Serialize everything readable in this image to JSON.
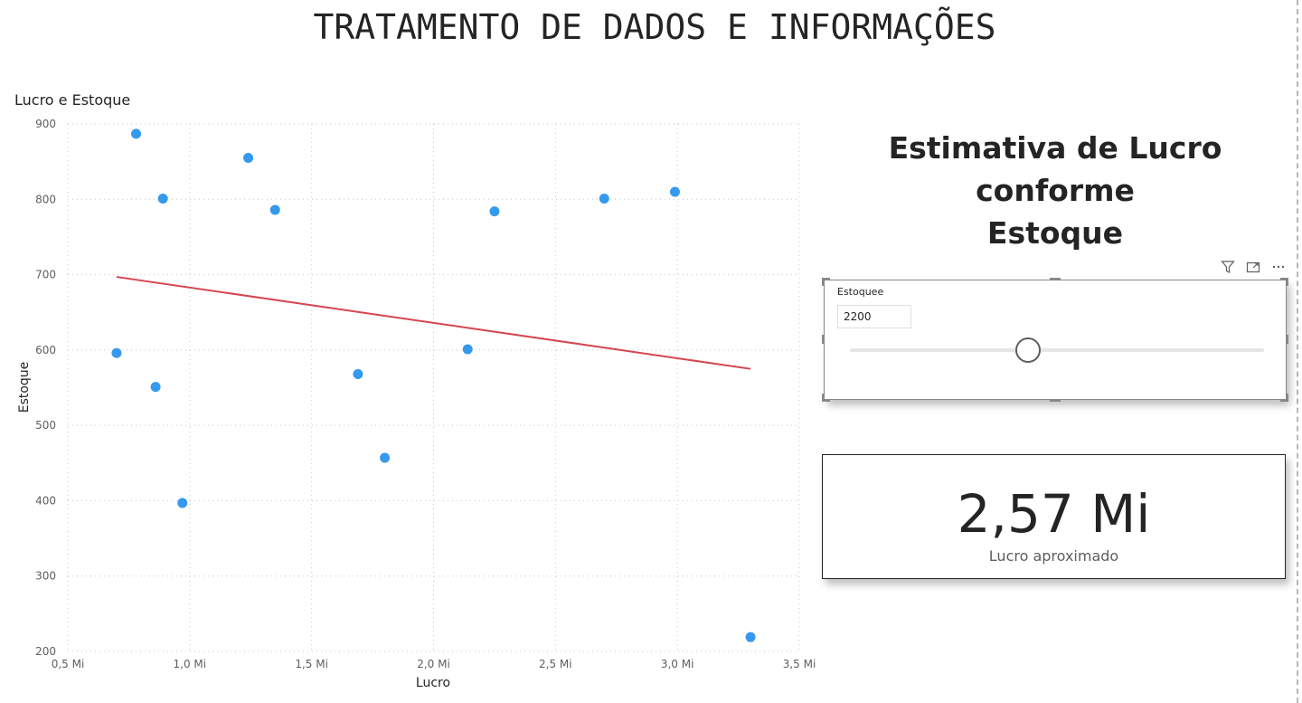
{
  "page": {
    "title": "TRATAMENTO DE DADOS E INFORMAÇÕES"
  },
  "chart_data": {
    "type": "scatter",
    "title": "Lucro e Estoque",
    "xlabel": "Lucro",
    "ylabel": "Estoque",
    "xlim": [
      0.5,
      3.5
    ],
    "ylim": [
      200,
      900
    ],
    "x_ticks": [
      0.5,
      1.0,
      1.5,
      2.0,
      2.5,
      3.0,
      3.5
    ],
    "x_tick_labels": [
      "0,5 Mi",
      "1,0 Mi",
      "1,5 Mi",
      "2,0 Mi",
      "2,5 Mi",
      "3,0 Mi",
      "3,5 Mi"
    ],
    "y_ticks": [
      200,
      300,
      400,
      500,
      600,
      700,
      800,
      900
    ],
    "y_tick_labels": [
      "200",
      "300",
      "400",
      "500",
      "600",
      "700",
      "800",
      "900"
    ],
    "grid": true,
    "point_color": "#3599ee",
    "trend_color": "#d64550",
    "points": [
      {
        "x": 0.78,
        "y": 887
      },
      {
        "x": 1.24,
        "y": 855
      },
      {
        "x": 0.89,
        "y": 801
      },
      {
        "x": 1.35,
        "y": 786
      },
      {
        "x": 2.25,
        "y": 784
      },
      {
        "x": 2.7,
        "y": 801
      },
      {
        "x": 2.99,
        "y": 810
      },
      {
        "x": 0.7,
        "y": 596
      },
      {
        "x": 0.86,
        "y": 551
      },
      {
        "x": 1.69,
        "y": 568
      },
      {
        "x": 2.14,
        "y": 601
      },
      {
        "x": 1.8,
        "y": 457
      },
      {
        "x": 0.97,
        "y": 397
      },
      {
        "x": 3.3,
        "y": 219
      }
    ],
    "trend_line": {
      "x": [
        0.7,
        3.3
      ],
      "y": [
        697,
        575
      ]
    }
  },
  "estimate": {
    "title_line1": "Estimativa de Lucro conforme",
    "title_line2": "Estoque"
  },
  "visual_header": {
    "icons": [
      "filter-icon",
      "focus-mode-icon",
      "more-options-icon"
    ]
  },
  "slicer": {
    "label": "Estoquee",
    "value": "2200",
    "fraction": 0.43
  },
  "card": {
    "value": "2,57 Mi",
    "label": "Lucro aproximado"
  }
}
